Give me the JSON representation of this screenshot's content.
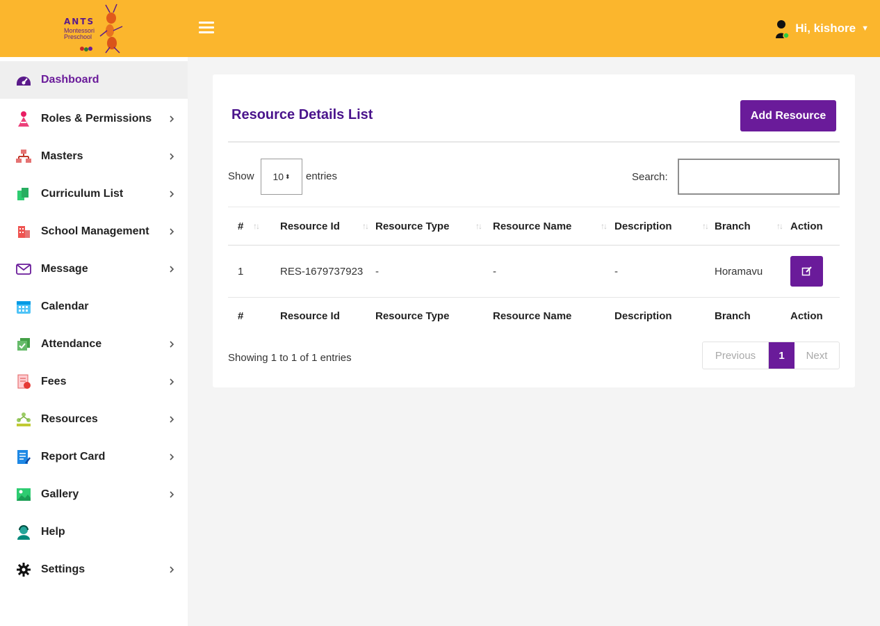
{
  "brand": {
    "name_line1": "ANTS",
    "name_line2": "Montessori Preschool"
  },
  "header": {
    "user_greeting": "Hi, kishore",
    "colors": {
      "bar": "#fbb62d",
      "accent": "#6a1b9a"
    }
  },
  "sidebar": {
    "items": [
      {
        "label": "Dashboard",
        "icon": "dashboard-icon",
        "active": true,
        "has_submenu": false
      },
      {
        "label": "Roles & Permissions",
        "icon": "roles-icon",
        "has_submenu": true
      },
      {
        "label": "Masters",
        "icon": "masters-icon",
        "has_submenu": true
      },
      {
        "label": "Curriculum List",
        "icon": "curriculum-icon",
        "has_submenu": true
      },
      {
        "label": "School Management",
        "icon": "school-icon",
        "has_submenu": true
      },
      {
        "label": "Message",
        "icon": "envelope-icon",
        "has_submenu": true
      },
      {
        "label": "Calendar",
        "icon": "calendar-icon",
        "has_submenu": false
      },
      {
        "label": "Attendance",
        "icon": "attendance-icon",
        "has_submenu": true
      },
      {
        "label": "Fees",
        "icon": "fees-icon",
        "has_submenu": true
      },
      {
        "label": "Resources",
        "icon": "resources-icon",
        "has_submenu": true
      },
      {
        "label": "Report Card",
        "icon": "report-card-icon",
        "has_submenu": true
      },
      {
        "label": "Gallery",
        "icon": "gallery-icon",
        "has_submenu": true
      },
      {
        "label": "Help",
        "icon": "help-icon",
        "has_submenu": false
      },
      {
        "label": "Settings",
        "icon": "gear-icon",
        "has_submenu": true
      }
    ]
  },
  "main": {
    "title": "Resource Details List",
    "add_button": "Add Resource",
    "length_menu": {
      "prefix": "Show",
      "value": "10",
      "suffix": "entries"
    },
    "search": {
      "label": "Search:",
      "value": ""
    },
    "table": {
      "columns": [
        "#",
        "Resource Id",
        "Resource Type",
        "Resource Name",
        "Description",
        "Branch",
        "Action"
      ],
      "rows": [
        {
          "num": "1",
          "resource_id": "RES-1679737923",
          "resource_type": "-",
          "resource_name": "-",
          "description": "-",
          "branch": "Horamavu"
        }
      ]
    },
    "info": "Showing 1 to 1 of 1 entries",
    "pagination": {
      "previous": "Previous",
      "current": "1",
      "next": "Next"
    }
  }
}
